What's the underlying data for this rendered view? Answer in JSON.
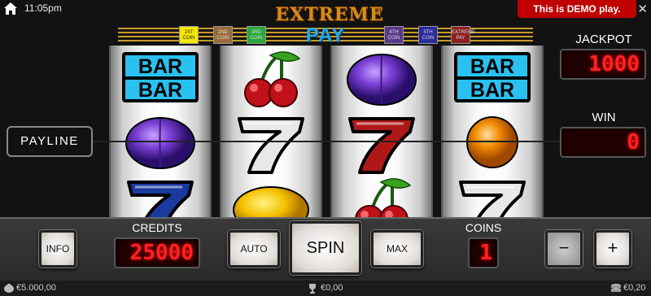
{
  "topbar": {
    "time": "11:05pm",
    "demo_notice": "This is DEMO play."
  },
  "logo": {
    "line1": "EXTREME",
    "registered": "®",
    "line2": "PAY"
  },
  "coin_labels": [
    {
      "text": "1ST COIN",
      "color": "#f5e800"
    },
    {
      "text": "2ND COIN",
      "color": "#9a6a3a"
    },
    {
      "text": "3RD COIN",
      "color": "#28a83a"
    },
    {
      "text": "4TH COIN",
      "color": "#5a3a8a"
    },
    {
      "text": "5TH COIN",
      "color": "#2a2a9a"
    },
    {
      "text": "EXTREME PAY",
      "color": "#8a2020"
    }
  ],
  "reels": [
    {
      "symbols": [
        "bar-bar",
        "plum",
        "seven-blue"
      ]
    },
    {
      "symbols": [
        "cherries",
        "seven-white",
        "lemon"
      ]
    },
    {
      "symbols": [
        "plum",
        "seven-red",
        "cherries"
      ]
    },
    {
      "symbols": [
        "bar-bar",
        "orange",
        "seven-white"
      ]
    }
  ],
  "payline_label": "PAYLINE",
  "jackpot": {
    "label": "JACKPOT",
    "value": "1000"
  },
  "win": {
    "label": "WIN",
    "value": "0"
  },
  "controls": {
    "info_label": "INFO",
    "credits_label": "CREDITS",
    "credits_value": "25000",
    "auto_label": "AUTO",
    "spin_label": "SPIN",
    "max_label": "MAX",
    "coins_label": "COINS",
    "coins_value": "1",
    "minus_label": "−",
    "plus_label": "+"
  },
  "status": {
    "balance": "€5.000,00",
    "win_total": "€0,00",
    "stake": "€0,20"
  },
  "colors": {
    "demo_red": "#c00000",
    "led_red": "#ff2222",
    "logo_orange": "#d98a1c",
    "logo_blue": "#24a8e6",
    "bar_blue": "#29c1f0"
  }
}
